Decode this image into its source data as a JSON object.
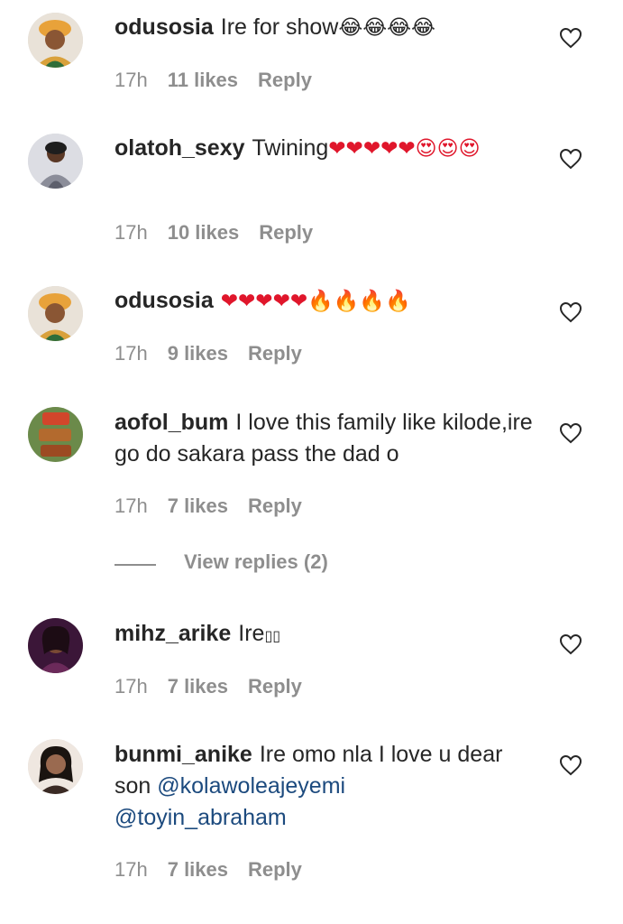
{
  "comments": [
    {
      "username": "odusosia",
      "text": "Ire for show",
      "emoji": "😂😂😂😂",
      "time": "17h",
      "likes": "11 likes",
      "reply": "Reply",
      "avatar_color": "#e8a23a"
    },
    {
      "username": "olatoh_sexy",
      "text": "Twining",
      "emoji": "❤❤❤❤❤😍😍😍",
      "time": "17h",
      "likes": "10 likes",
      "reply": "Reply",
      "avatar_color": "#c9c9d2"
    },
    {
      "username": "odusosia",
      "text": "",
      "emoji": "❤❤❤❤❤🔥🔥🔥🔥",
      "time": "17h",
      "likes": "9 likes",
      "reply": "Reply",
      "avatar_color": "#e8a23a"
    },
    {
      "username": "aofol_bum",
      "text": "I love this family like kilode,ire go do sakara pass the dad o",
      "time": "17h",
      "likes": "7 likes",
      "reply": "Reply",
      "view_replies": "View replies (2)",
      "avatar_color": "#b36a2e"
    },
    {
      "username": "mihz_arike",
      "text": "Ire",
      "emoji": "▯▯",
      "time": "17h",
      "likes": "7 likes",
      "reply": "Reply",
      "avatar_color": "#6b2a5a"
    },
    {
      "username": "bunmi_anike",
      "text": "Ire omo nla I love u dear son",
      "mentions": [
        "@kolawoleajeyemi",
        "@toyin_abraham"
      ],
      "time": "17h",
      "likes": "7 likes",
      "reply": "Reply",
      "avatar_color": "#3a2a24"
    }
  ],
  "icons": {
    "like": "heart-outline-icon"
  },
  "colors": {
    "text": "#262626",
    "meta": "#8e8e8e",
    "mention": "#1c4a7e",
    "heart": "#e0162b"
  }
}
